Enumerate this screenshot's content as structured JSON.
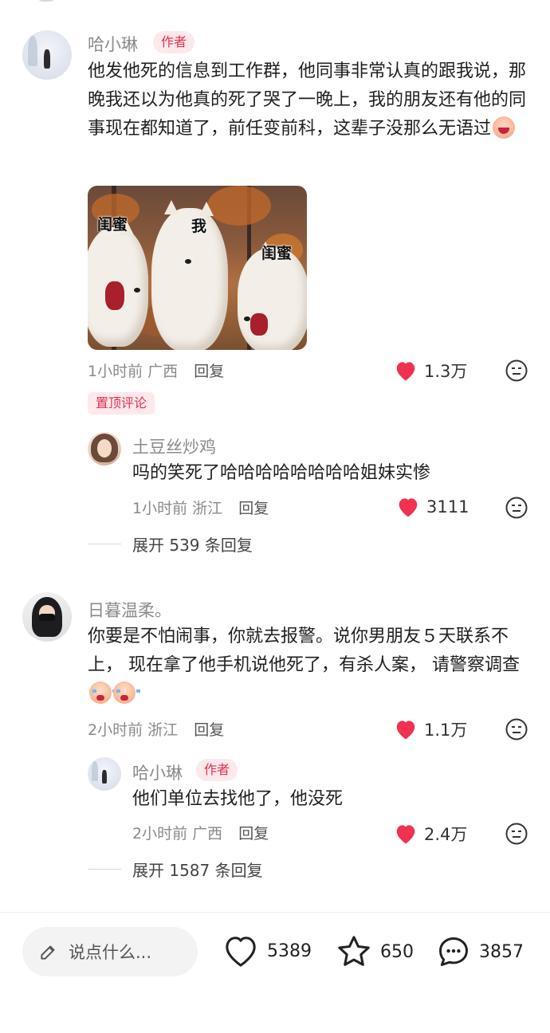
{
  "comments": [
    {
      "user": "哈小琳",
      "author_tag": "作者",
      "text": "他发他死的信息到工作群，他同事非常认真的跟我说，那晚我还以为他真的死了哭了一晚上，我的朋友还有他的同事现在都知道了，前任变前科，这辈子没那么无语过",
      "image_labels": [
        "闺蜜",
        "我",
        "闺蜜"
      ],
      "time": "1小时前",
      "location": "广西",
      "reply_label": "回复",
      "likes": "1.3万",
      "pinned_tag": "置顶评论",
      "replies": [
        {
          "user": "土豆丝炒鸡",
          "text": "吗的笑死了哈哈哈哈哈哈哈哈姐妹实惨",
          "time": "1小时前",
          "location": "浙江",
          "reply_label": "回复",
          "likes": "3111"
        }
      ],
      "expand_label": "展开 539 条回复"
    },
    {
      "user": "日暮温柔。",
      "text": "你要是不怕闹事，你就去报警。说你男朋友５天联系不上， 现在拿了他手机说他死了，有杀人案， 请警察调查",
      "time": "2小时前",
      "location": "浙江",
      "reply_label": "回复",
      "likes": "1.1万",
      "replies": [
        {
          "user": "哈小琳",
          "author_tag": "作者",
          "text": "他们单位去找他了，他没死",
          "time": "2小时前",
          "location": "广西",
          "reply_label": "回复",
          "likes": "2.4万"
        }
      ],
      "expand_label": "展开 1587 条回复"
    }
  ],
  "bottom_bar": {
    "input_placeholder": "说点什么...",
    "likes": "5389",
    "favorites": "650",
    "comments": "3857"
  },
  "colors": {
    "heart": "#f0314f",
    "tag_text": "#e0304e",
    "tag_bg": "#fde8ec"
  },
  "icons": [
    "pencil-icon",
    "heart-outline-icon",
    "star-outline-icon",
    "chat-bubble-icon",
    "heart-filled-icon",
    "more-face-icon"
  ]
}
